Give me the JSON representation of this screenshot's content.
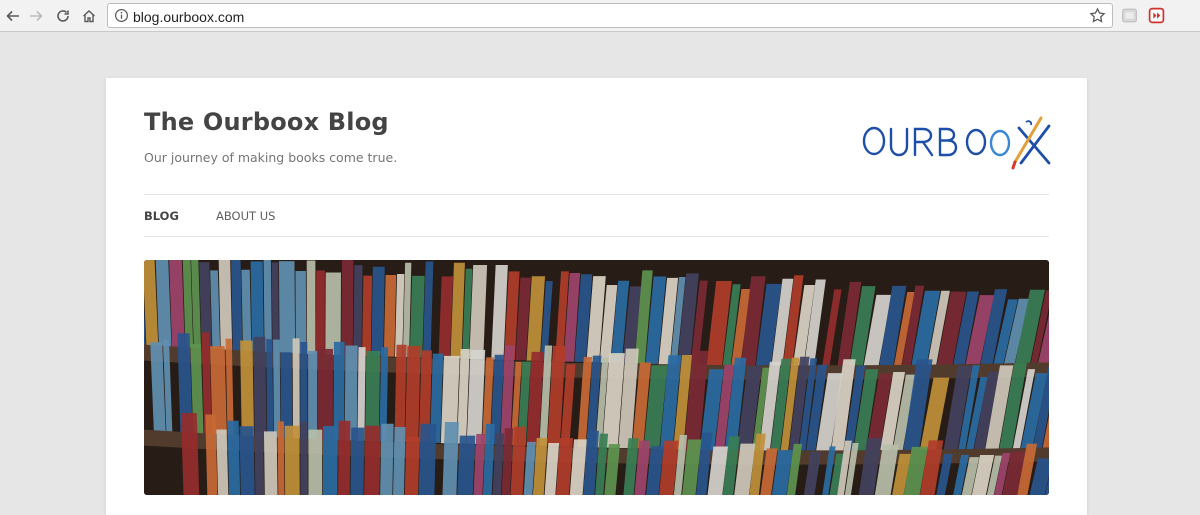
{
  "browser": {
    "url": "blog.ourboox.com",
    "icons": [
      "back-arrow-icon",
      "forward-arrow-icon",
      "reload-icon",
      "home-icon",
      "info-icon",
      "star-icon",
      "extension-icon",
      "extension-red-icon"
    ]
  },
  "site": {
    "title": "The Ourboox Blog",
    "tagline": "Our journey of making books come true.",
    "logo_text": "OURBOOX",
    "nav": [
      {
        "label": "BLOG",
        "active": true
      },
      {
        "label": "ABOUT US",
        "active": false
      }
    ]
  },
  "colors": {
    "logo_blue": "#1e4fa8",
    "title_text": "#444444",
    "accent_red": "#d33a2c"
  }
}
